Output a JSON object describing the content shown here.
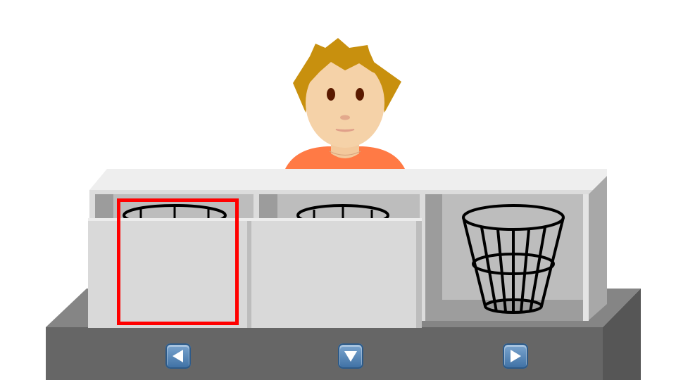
{
  "scene": {
    "character": {
      "name": "person-with-blond-hair",
      "hair_color": "#c8900e",
      "skin_color": "#f5d2a8",
      "shirt_color": "#ff7a45"
    },
    "booths": {
      "count": 3,
      "covered": [
        true,
        true,
        false
      ],
      "selected_index": 0,
      "revealed_item": "wastebasket-icon"
    },
    "colors": {
      "selection": "#ff0000",
      "platform_top": "#858585",
      "platform_front": "#666666",
      "cover": "#d9d9d9",
      "button": "#4f80b3"
    }
  },
  "controls": {
    "left_icon": "triangle-left-icon",
    "down_icon": "triangle-down-icon",
    "right_icon": "triangle-right-icon"
  }
}
